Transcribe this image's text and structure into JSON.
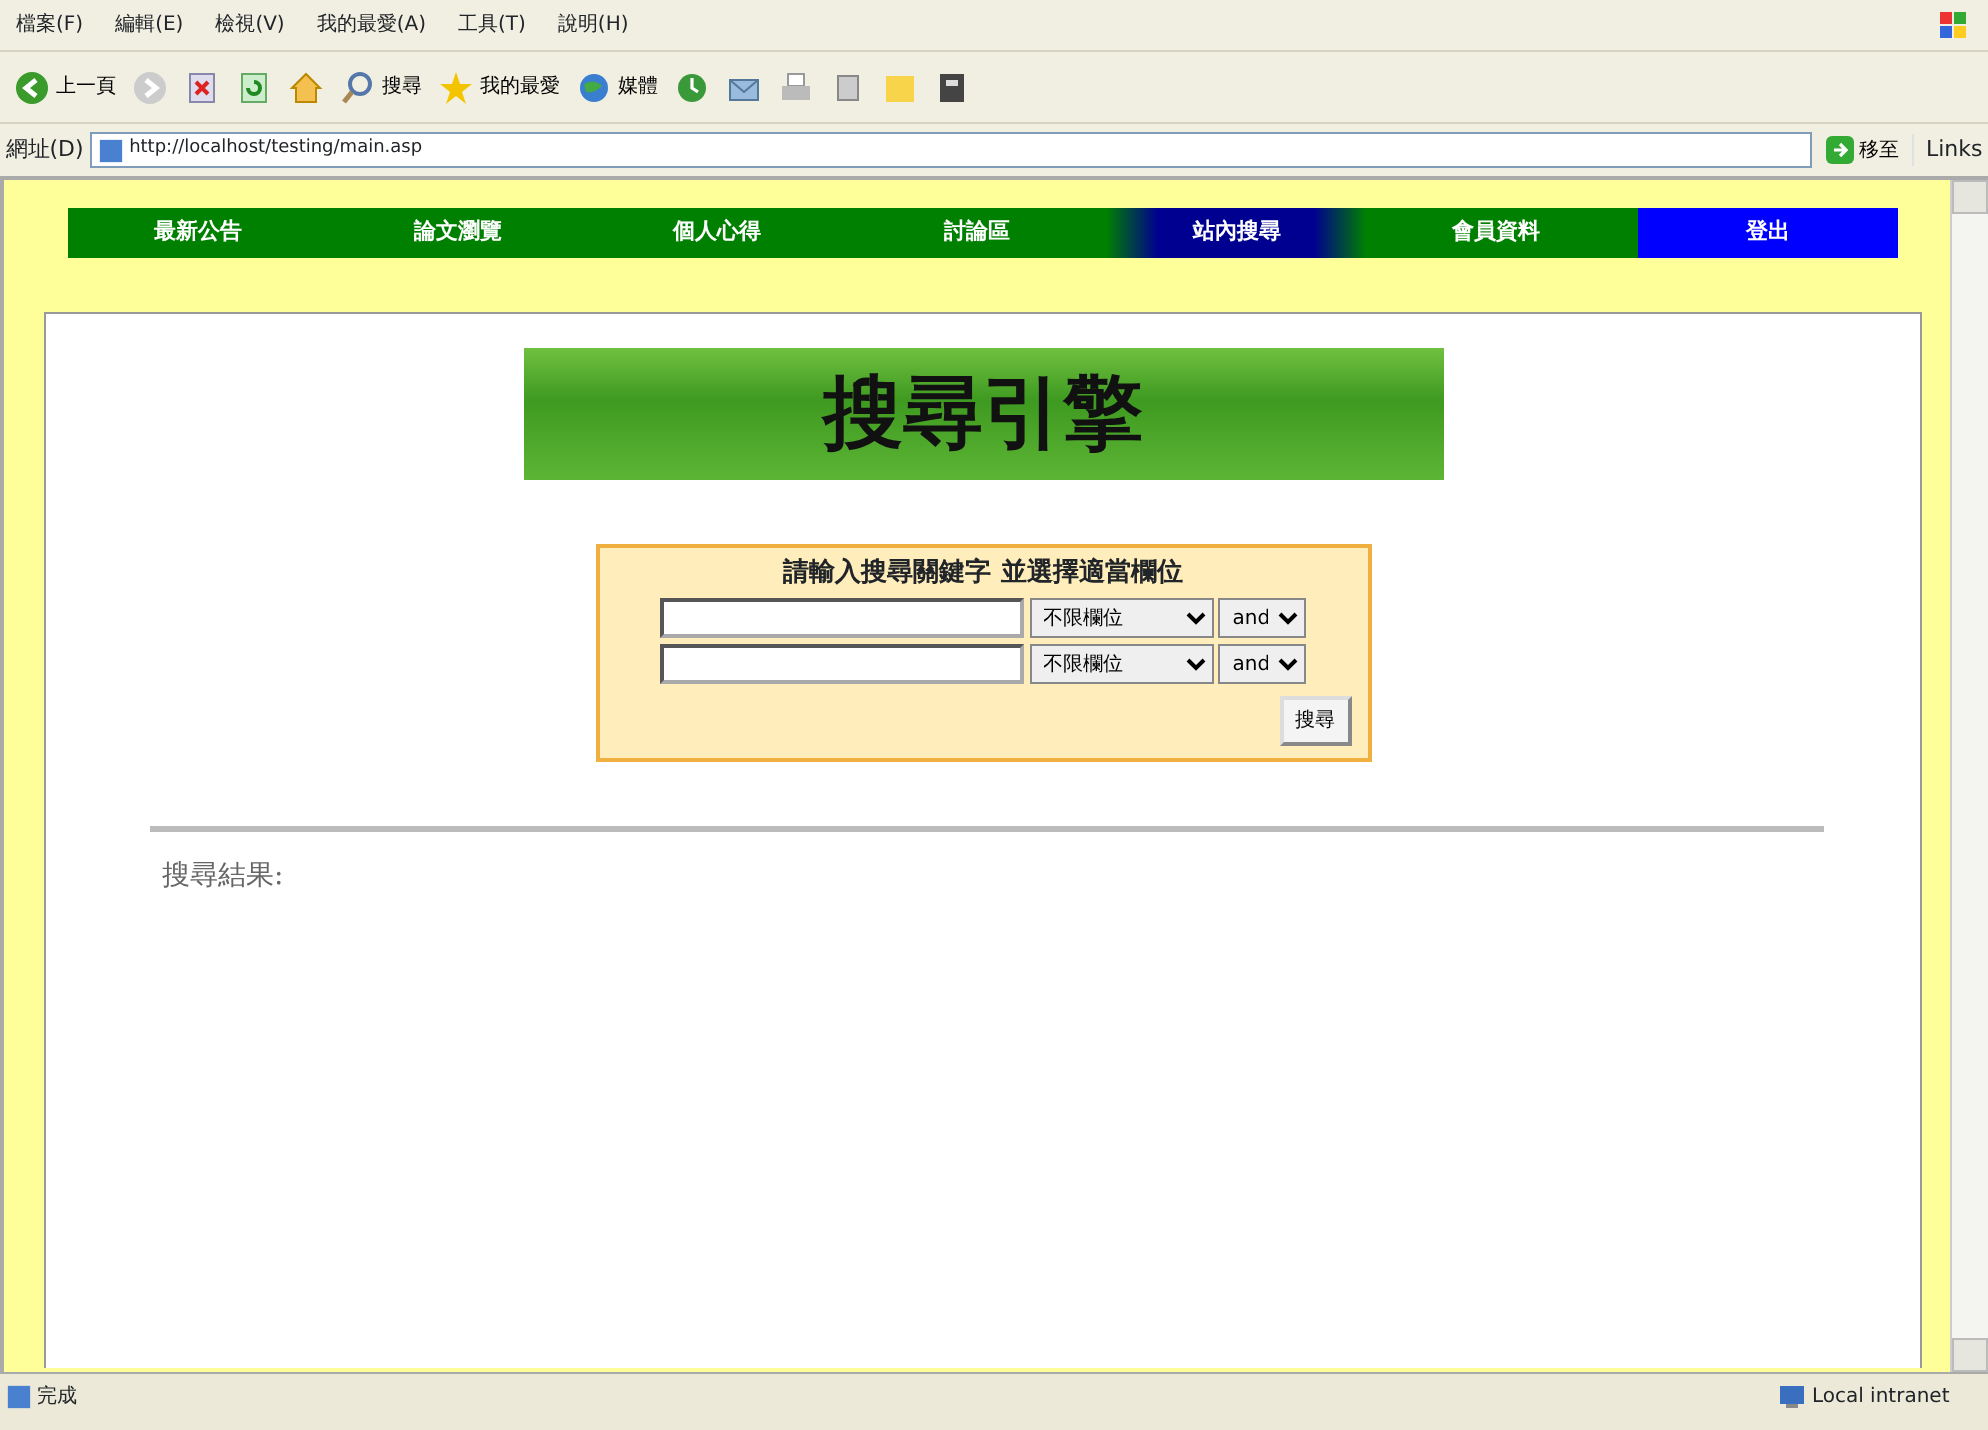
{
  "menu_bar": [
    "檔案(F)",
    "編輯(E)",
    "檢視(V)",
    "我的最愛(A)",
    "工具(T)",
    "說明(H)"
  ],
  "toolbar": [
    {
      "kind": "back",
      "label": "上一頁"
    },
    {
      "kind": "forward"
    },
    {
      "kind": "stop"
    },
    {
      "kind": "refresh"
    },
    {
      "kind": "home"
    },
    {
      "kind": "search",
      "label": "搜尋"
    },
    {
      "kind": "favorites",
      "label": "我的最愛"
    },
    {
      "kind": "media",
      "label": "媒體"
    },
    {
      "kind": "history"
    },
    {
      "kind": "mail"
    },
    {
      "kind": "print"
    },
    {
      "kind": "edit"
    },
    {
      "kind": "folder"
    },
    {
      "kind": "book"
    }
  ],
  "address_bar": {
    "label": "網址(D)",
    "value": "http://localhost/testing/main.asp",
    "go": "移至",
    "links": "Links"
  },
  "nav": [
    {
      "label": "最新公告",
      "kind": "link",
      "selected": false
    },
    {
      "label": "論文瀏覽",
      "kind": "link",
      "selected": false
    },
    {
      "label": "個人心得",
      "kind": "link",
      "selected": false
    },
    {
      "label": "討論區",
      "kind": "link",
      "selected": false
    },
    {
      "label": "站內搜尋",
      "kind": "link",
      "selected": true
    },
    {
      "label": "會員資料",
      "kind": "link",
      "selected": false
    },
    {
      "label": "登出",
      "kind": "logout",
      "selected": false
    }
  ],
  "banner": "搜尋引擎",
  "search_form": {
    "title": "請輸入搜尋關鍵字 並選擇適當欄位",
    "rows": [
      {
        "field": "不限欄位",
        "operator": "and"
      },
      {
        "field": "不限欄位",
        "operator": "and"
      }
    ],
    "button": "搜尋"
  },
  "results_label": "搜尋結果:",
  "status_bar": {
    "text": "完成",
    "zone": "Local intranet"
  }
}
